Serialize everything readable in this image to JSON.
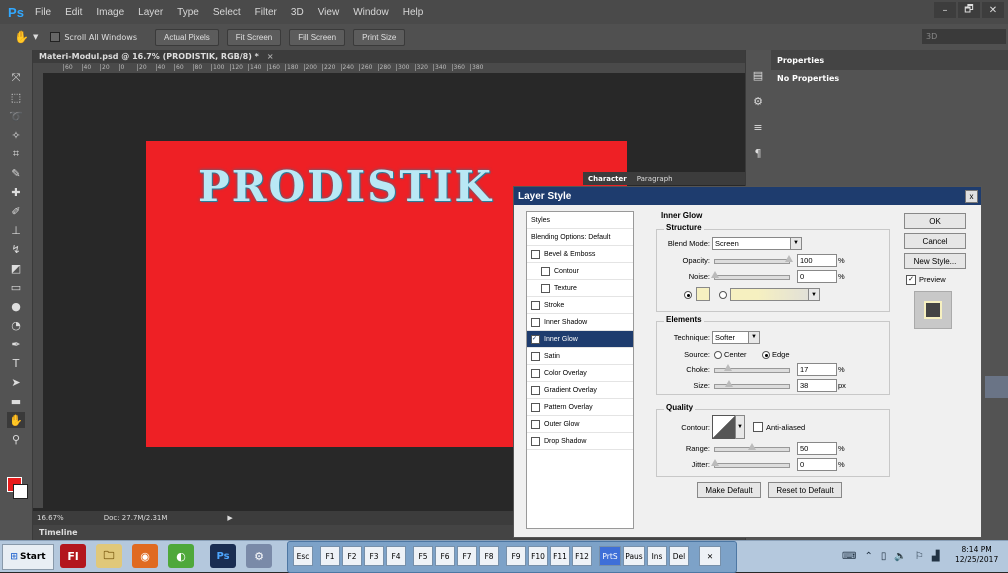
{
  "app": {
    "logo": "Ps"
  },
  "menu": [
    "File",
    "Edit",
    "Image",
    "Layer",
    "Type",
    "Select",
    "Filter",
    "3D",
    "View",
    "Window",
    "Help"
  ],
  "window_controls": [
    "–",
    "🗗",
    "✕"
  ],
  "options_bar": {
    "scroll_all": "Scroll All Windows",
    "buttons": [
      "Actual Pixels",
      "Fit Screen",
      "Fill Screen",
      "Print Size"
    ],
    "workspace": "3D"
  },
  "document": {
    "tab_title": "Materi-Modul.psd @ 16.7% (PRODISTIK, RGB/8) *",
    "tab_close": "×",
    "canvas_text": "PRODISTIK"
  },
  "ruler_ticks": [
    "60",
    "40",
    "20",
    "0",
    "20",
    "40",
    "60",
    "80",
    "100",
    "120",
    "140",
    "160",
    "180",
    "200",
    "220",
    "240",
    "260",
    "280",
    "300",
    "320",
    "340",
    "360",
    "380"
  ],
  "status": {
    "zoom": "16.67%",
    "doc": "Doc: 27.7M/2.31M"
  },
  "timeline": "Timeline",
  "properties": {
    "tab": "Properties",
    "body": "No Properties"
  },
  "char_panel": {
    "tabs": [
      "Character",
      "Paragraph"
    ]
  },
  "dialog": {
    "title": "Layer Style",
    "close": "x",
    "styles": [
      {
        "label": "Styles",
        "checkbox": false,
        "sub": false
      },
      {
        "label": "Blending Options: Default",
        "checkbox": false,
        "sub": false
      },
      {
        "label": "Bevel & Emboss",
        "checkbox": true,
        "sub": false
      },
      {
        "label": "Contour",
        "checkbox": true,
        "sub": true
      },
      {
        "label": "Texture",
        "checkbox": true,
        "sub": true
      },
      {
        "label": "Stroke",
        "checkbox": true,
        "sub": false
      },
      {
        "label": "Inner Shadow",
        "checkbox": true,
        "sub": false
      },
      {
        "label": "Inner Glow",
        "checkbox": true,
        "sub": false,
        "selected": true
      },
      {
        "label": "Satin",
        "checkbox": true,
        "sub": false
      },
      {
        "label": "Color Overlay",
        "checkbox": true,
        "sub": false
      },
      {
        "label": "Gradient Overlay",
        "checkbox": true,
        "sub": false
      },
      {
        "label": "Pattern Overlay",
        "checkbox": true,
        "sub": false
      },
      {
        "label": "Outer Glow",
        "checkbox": true,
        "sub": false
      },
      {
        "label": "Drop Shadow",
        "checkbox": true,
        "sub": false
      }
    ],
    "inner_glow": {
      "heading": "Inner Glow",
      "structure": "Structure",
      "blend_mode_label": "Blend Mode:",
      "blend_mode": "Screen",
      "opacity_label": "Opacity:",
      "opacity": "100",
      "noise_label": "Noise:",
      "noise": "0",
      "pct": "%",
      "px": "px",
      "glow_color": "#f6f0c0",
      "elements": "Elements",
      "technique_label": "Technique:",
      "technique": "Softer",
      "source_label": "Source:",
      "source_center": "Center",
      "source_edge": "Edge",
      "choke_label": "Choke:",
      "choke": "17",
      "size_label": "Size:",
      "size": "38",
      "quality": "Quality",
      "contour_label": "Contour:",
      "anti_aliased": "Anti-aliased",
      "range_label": "Range:",
      "range": "50",
      "jitter_label": "Jitter:",
      "jitter": "0",
      "make_default": "Make Default",
      "reset_default": "Reset to Default"
    },
    "buttons": {
      "ok": "OK",
      "cancel": "Cancel",
      "new_style": "New Style...",
      "preview": "Preview"
    }
  },
  "taskbar": {
    "start": "Start",
    "osk_keys": [
      "Esc",
      "F1",
      "F2",
      "F3",
      "F4",
      "F5",
      "F6",
      "F7",
      "F8",
      "F9",
      "F10",
      "F11",
      "F12",
      "PrtS",
      "Paus",
      "Ins",
      "Del"
    ],
    "time": "8:14 PM",
    "date": "12/25/2017"
  }
}
